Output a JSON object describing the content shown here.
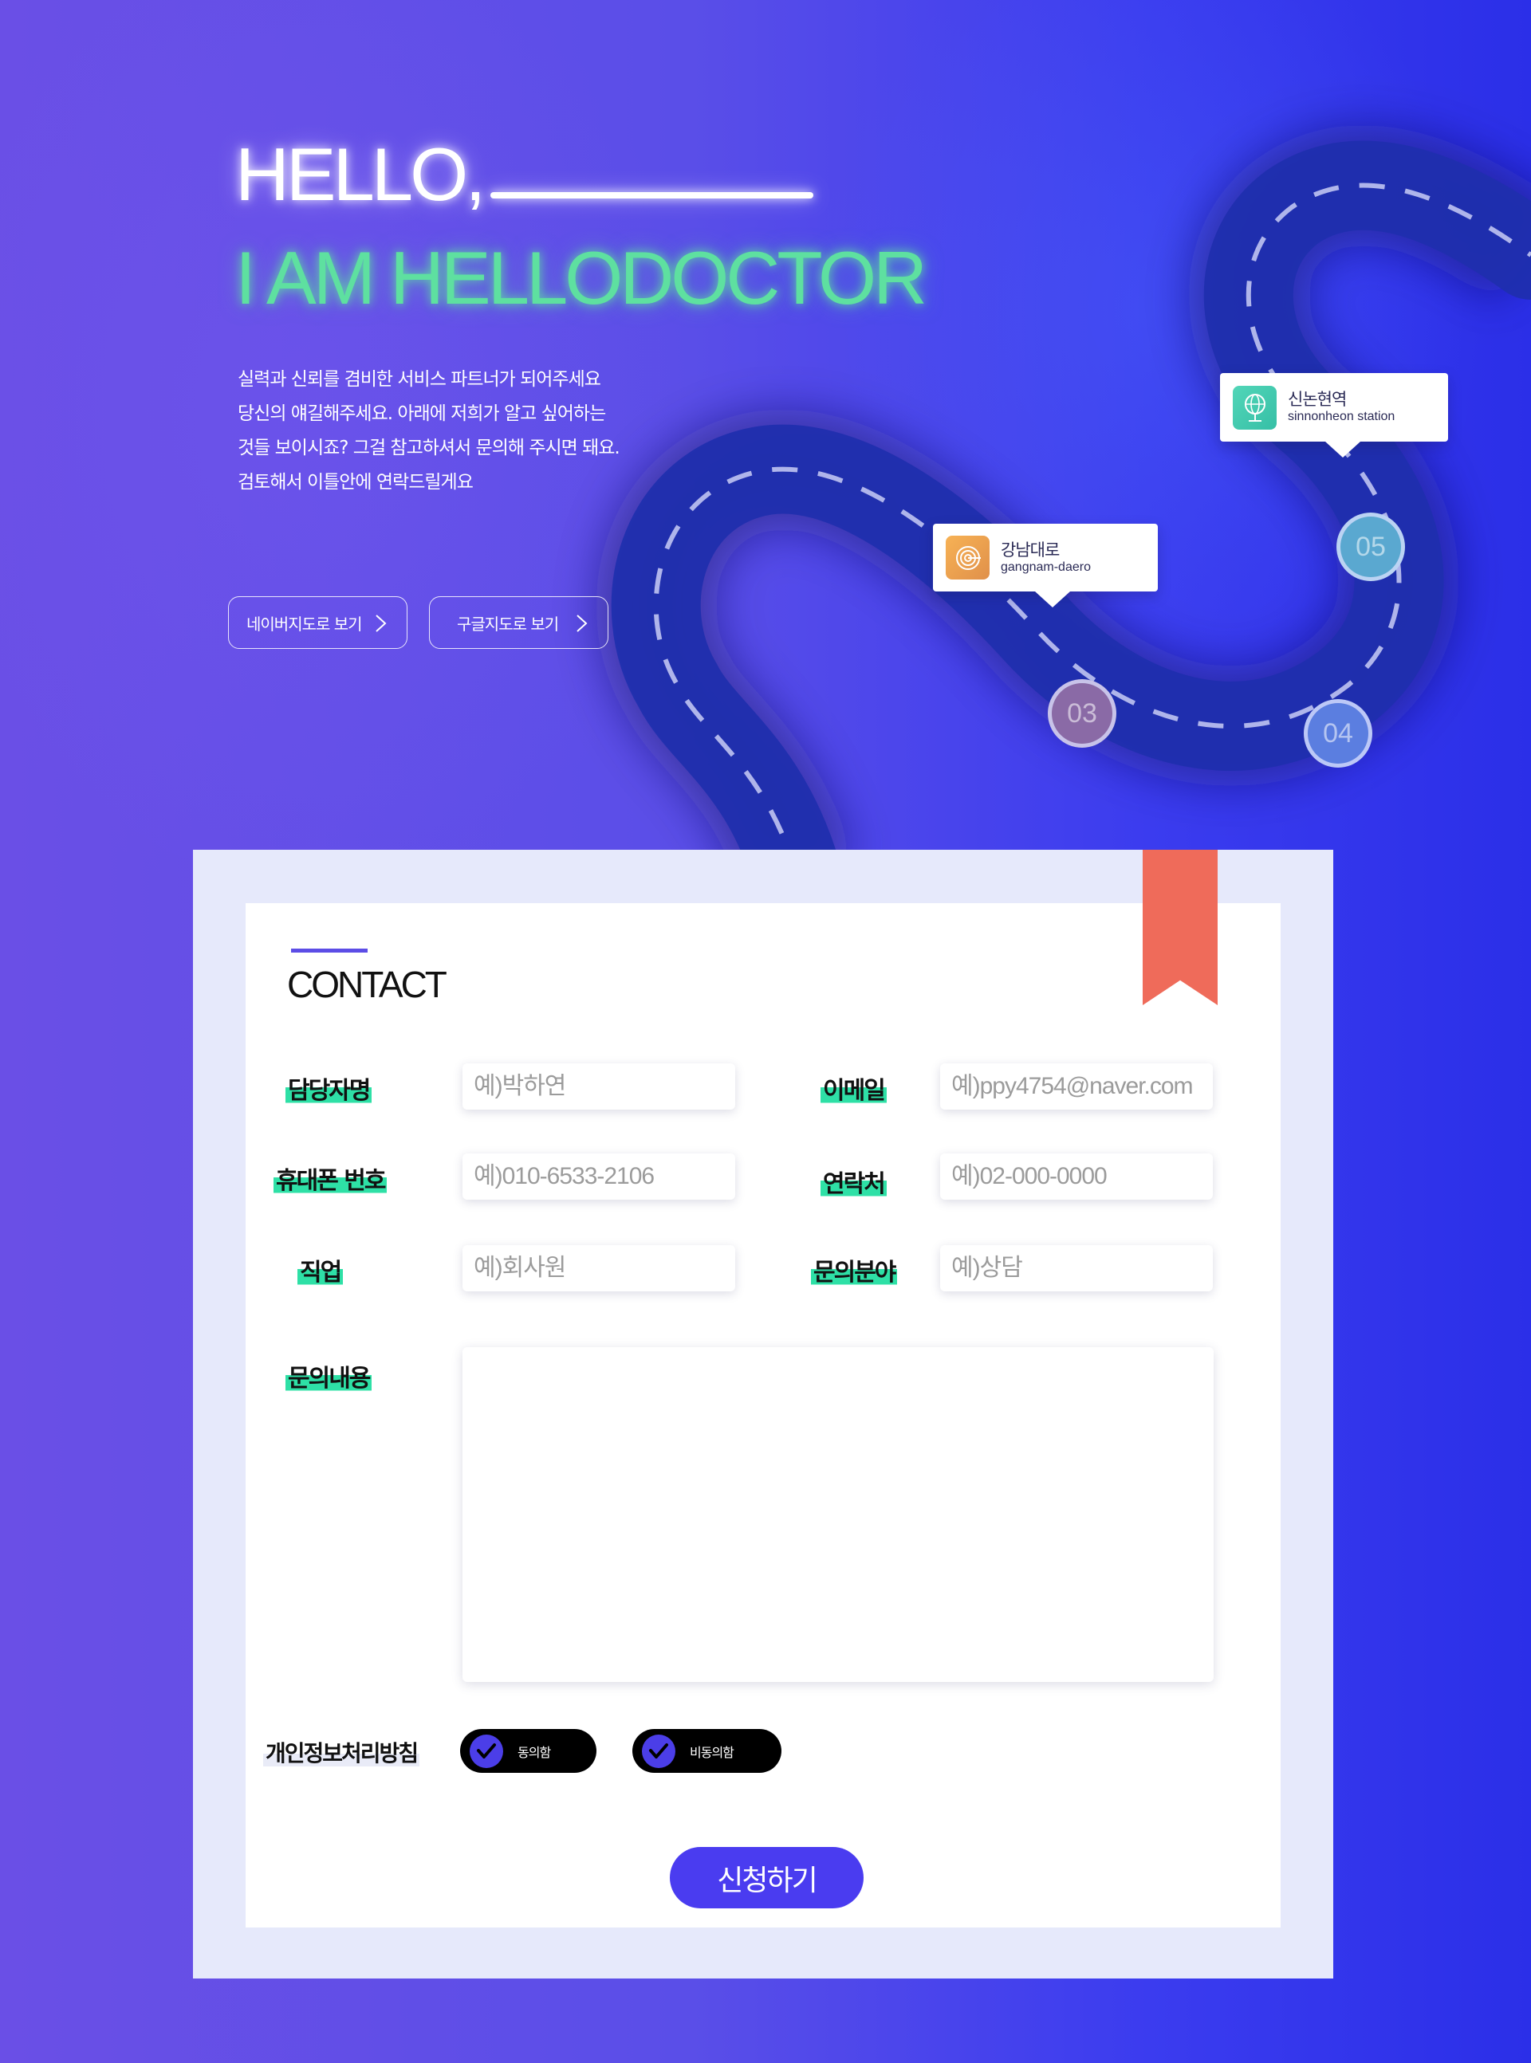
{
  "hero": {
    "hello": "HELLO,",
    "iam": "I AM HELLODOCTOR",
    "intro_lines": [
      "실력과 신뢰를 겸비한 서비스 파트너가 되어주세요",
      "당신의 얘길해주세요. 아래에 저희가 알고 싶어하는",
      "것들 보이시죠?  그걸 참고하셔서 문의해 주시면 돼요.",
      "검토해서 이틀안에 연락드릴게요"
    ],
    "buttons": {
      "naver": "네이버지도로 보기",
      "google": "구글지도로 보기"
    }
  },
  "map": {
    "pins": {
      "gangnam": {
        "name": "강남대로",
        "sub": "gangnam-daero"
      },
      "sinnon": {
        "name": "신논현역",
        "sub": "sinnonheon station"
      }
    },
    "stations": {
      "s03": "03",
      "s04": "04",
      "s05": "05"
    }
  },
  "contact": {
    "title": "CONTACT",
    "fields": {
      "name": {
        "label": "담당자명",
        "placeholder": "예)박하연"
      },
      "email": {
        "label": "이메일",
        "placeholder": "예)ppy4754@naver.com"
      },
      "mobile": {
        "label": "휴대폰 번호",
        "placeholder": "예)010-6533-2106"
      },
      "phone": {
        "label": "연락처",
        "placeholder": "예)02-000-0000"
      },
      "job": {
        "label": "직업",
        "placeholder": "예)회사원"
      },
      "topic": {
        "label": "문의분야",
        "placeholder": "예)상담"
      },
      "message": {
        "label": "문의내용",
        "placeholder": ""
      }
    },
    "privacy": {
      "label": "개인정보처리방침",
      "agree": "동의함",
      "disagree": "비동의함"
    },
    "submit": "신청하기"
  },
  "colors": {
    "accent": "#4a3cf0",
    "highlight": "#2ee0a6",
    "bookmark": "#ef6b5a",
    "neon_green": "#5ee0a0"
  }
}
